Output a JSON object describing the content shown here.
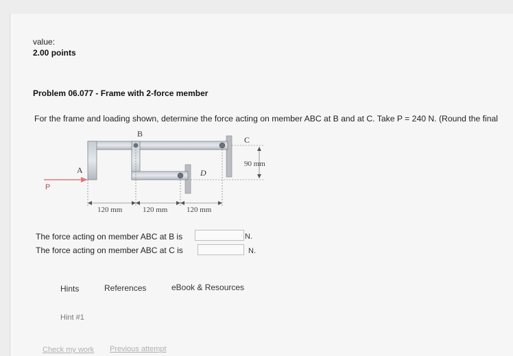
{
  "header": {
    "value_label": "value:",
    "points": "2.00 points"
  },
  "problem": {
    "title": "Problem 06.077 - Frame with 2-force member",
    "text": "For the frame and loading shown, determine the force acting on member ABC at B and at C. Take P = 240 N. (Round the final"
  },
  "figure": {
    "labels": {
      "B": "B",
      "C": "C",
      "A": "A",
      "D": "D",
      "P": "P"
    },
    "dimensions": {
      "vertical": "90 mm",
      "spans": [
        "120 mm",
        "120 mm",
        "120 mm"
      ]
    }
  },
  "questions": [
    {
      "label": "The force acting on member ABC at B is",
      "value": "",
      "unit": "N."
    },
    {
      "label": "The force acting on member ABC at C is",
      "value": "",
      "unit": "N."
    }
  ],
  "tabs": [
    "Hints",
    "References",
    "eBook & Resources"
  ],
  "hint": "Hint #1",
  "footer": {
    "check_work": "Check my work",
    "previous_attempt": "Previous attempt"
  }
}
